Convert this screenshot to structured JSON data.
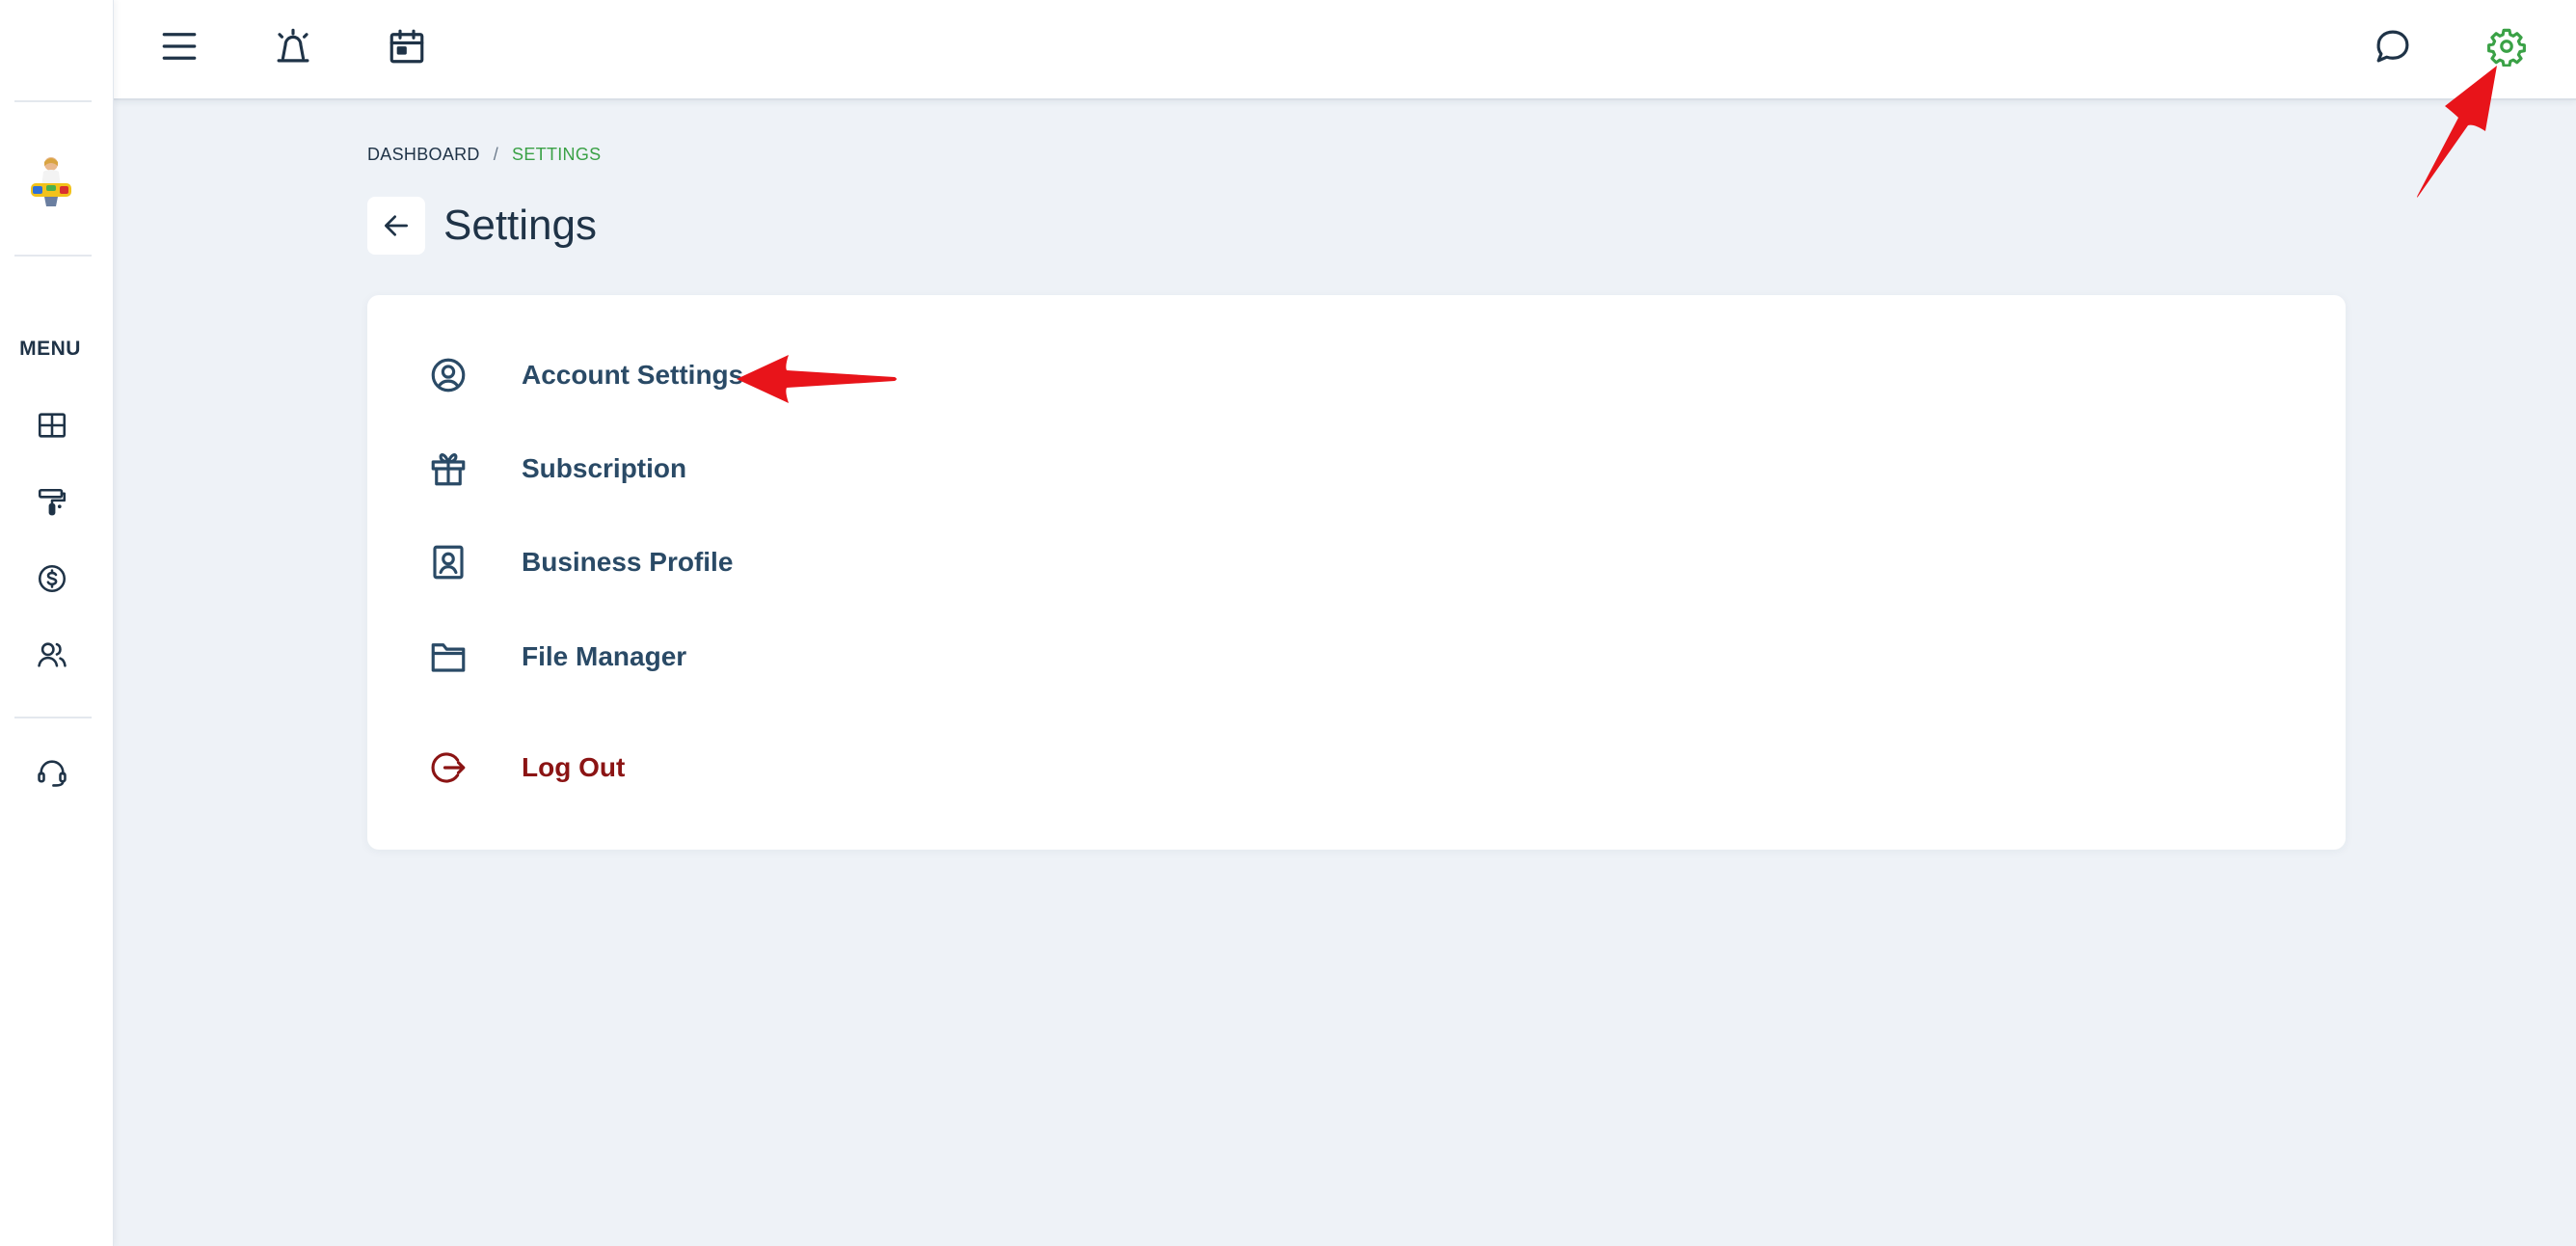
{
  "app": {
    "title": "Settings"
  },
  "sidebar": {
    "menu_label": "MENU",
    "items": [
      {
        "icon": "dashboard-icon"
      },
      {
        "icon": "paint-roller-icon"
      },
      {
        "icon": "dollar-circle-icon"
      },
      {
        "icon": "users-icon"
      },
      {
        "icon": "headset-icon"
      }
    ]
  },
  "topbar": {
    "icons": [
      "hamburger-menu-icon",
      "alarm-siren-icon",
      "calendar-icon",
      "chat-bubble-icon",
      "settings-gear-icon"
    ],
    "active_color": "#3aa146"
  },
  "breadcrumb": {
    "items": [
      "DASHBOARD",
      "SETTINGS"
    ],
    "separator": "/"
  },
  "page": {
    "title": "Settings"
  },
  "settings_menu": {
    "items": [
      {
        "label": "Account Settings",
        "icon": "user-circle-icon"
      },
      {
        "label": "Subscription",
        "icon": "gift-icon"
      },
      {
        "label": "Business Profile",
        "icon": "id-badge-icon"
      },
      {
        "label": "File Manager",
        "icon": "folder-icon"
      }
    ],
    "logout": {
      "label": "Log Out",
      "icon": "logout-icon",
      "color": "#8b1414"
    }
  },
  "colors": {
    "background": "#eef2f7",
    "text": "#1f3347",
    "accent_green": "#3aa146",
    "annotation_red": "#e8141a"
  }
}
